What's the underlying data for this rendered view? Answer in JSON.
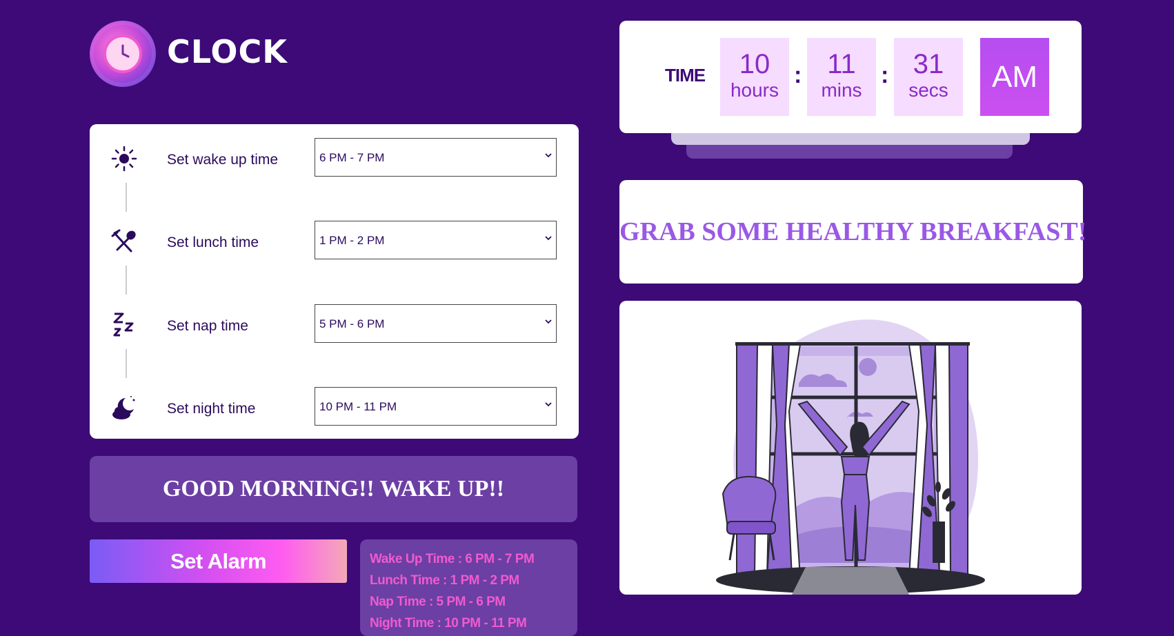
{
  "app": {
    "title": "CLOCK",
    "logo_icon": "clock-icon"
  },
  "schedule": {
    "rows": [
      {
        "icon": "sun-icon",
        "label": "Set wake up time",
        "value": "6 PM - 7 PM"
      },
      {
        "icon": "fork-knife-icon",
        "label": "Set lunch time",
        "value": "1 PM - 2 PM"
      },
      {
        "icon": "zzz-icon",
        "label": "Set nap time",
        "value": "5 PM - 6 PM"
      },
      {
        "icon": "moon-cloud-icon",
        "label": "Set night time",
        "value": "10 PM - 11 PM"
      }
    ]
  },
  "greeting": "GOOD MORNING!! WAKE UP!!",
  "alarm_button": "Set Alarm",
  "summary": {
    "lines": [
      "Wake Up Time : 6 PM - 7 PM",
      "Lunch Time : 1 PM - 2 PM",
      "Nap Time : 5 PM - 6 PM",
      "Night Time : 10 PM - 11 PM"
    ]
  },
  "clock": {
    "label": "TIME",
    "hours": "10",
    "hours_unit": "hours",
    "mins": "11",
    "mins_unit": "mins",
    "secs": "31",
    "secs_unit": "secs",
    "period": "AM",
    "separator": ":"
  },
  "message": "GRAB SOME HEALTHY BREAKFAST!",
  "colors": {
    "background": "#3d0a78",
    "accent_pink": "#f05ad0",
    "accent_purple": "#9a58e6",
    "panel_purple": "#6b3fa3"
  }
}
